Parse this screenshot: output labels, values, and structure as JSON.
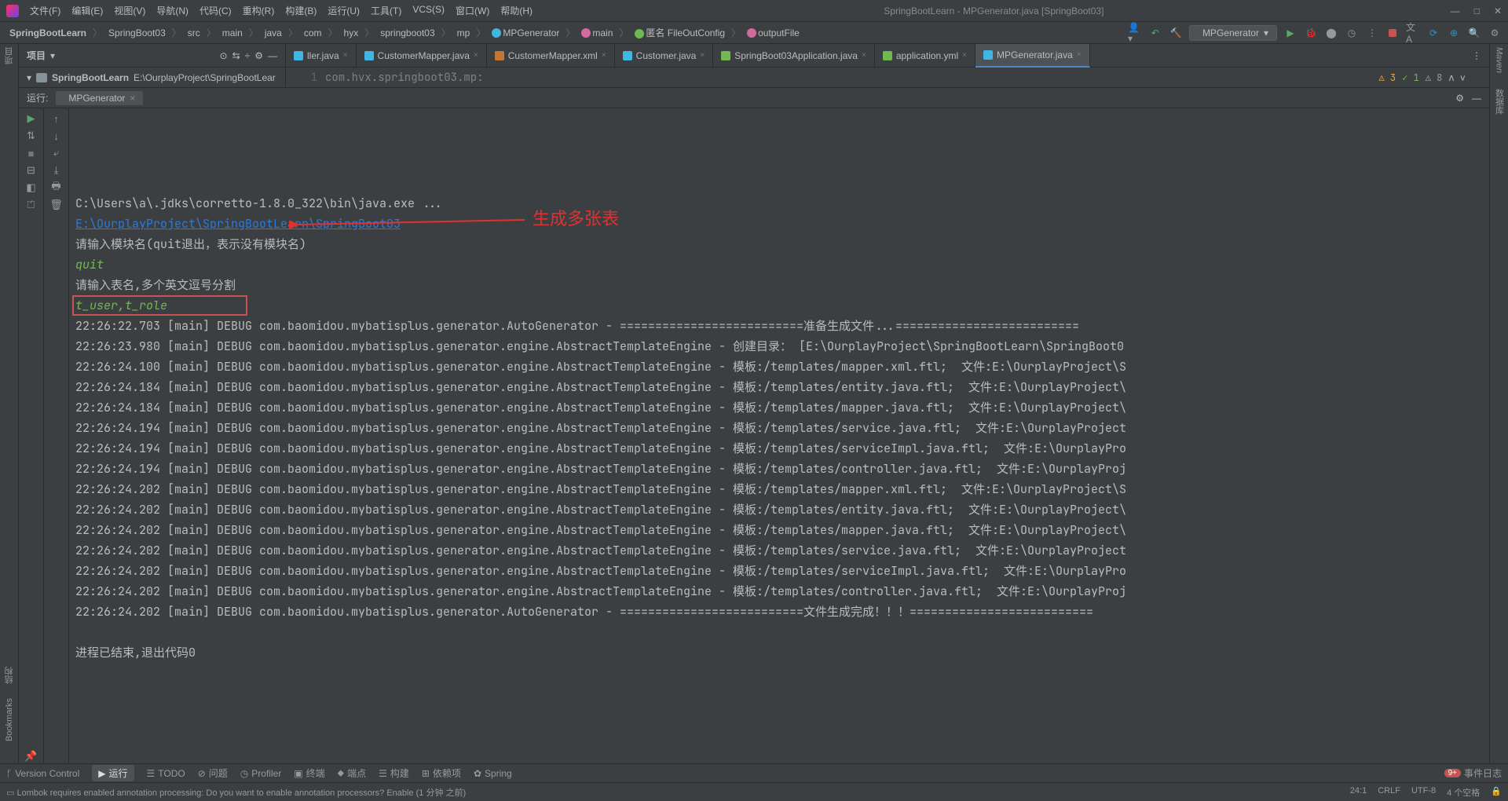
{
  "titlebar": {
    "menus": [
      "文件(F)",
      "编辑(E)",
      "视图(V)",
      "导航(N)",
      "代码(C)",
      "重构(R)",
      "构建(B)",
      "运行(U)",
      "工具(T)",
      "VCS(S)",
      "窗口(W)",
      "帮助(H)"
    ],
    "title": "SpringBootLearn - MPGenerator.java [SpringBoot03]"
  },
  "breadcrumb": [
    "SpringBootLearn",
    "SpringBoot03",
    "src",
    "main",
    "java",
    "com",
    "hyx",
    "springboot03",
    "mp",
    "MPGenerator",
    "main",
    "匿名 FileOutConfig",
    "outputFile"
  ],
  "run_config": "MPGenerator",
  "project_panel": {
    "label": "项目",
    "name": "SpringBootLearn",
    "path": "E:\\OurplayProject\\SpringBootLear"
  },
  "editor_tabs": [
    {
      "label": "ller.java",
      "icon": "#40b6e0"
    },
    {
      "label": "CustomerMapper.java",
      "icon": "#40b6e0"
    },
    {
      "label": "CustomerMapper.xml",
      "icon": "#c57633"
    },
    {
      "label": "Customer.java",
      "icon": "#40b6e0"
    },
    {
      "label": "SpringBoot03Application.java",
      "icon": "#6fb950"
    },
    {
      "label": "application.yml",
      "icon": "#6fb950"
    },
    {
      "label": "MPGenerator.java",
      "icon": "#40b6e0",
      "active": true
    }
  ],
  "editor": {
    "gutter": "1",
    "code": "com.hvx.springboot03.mp:",
    "warn": "3",
    "ok": "1",
    "info": "8"
  },
  "run": {
    "label": "运行:",
    "tab": "MPGenerator",
    "lines": [
      {
        "t": "plain",
        "text": "C:\\Users\\a\\.jdks\\corretto-1.8.0_322\\bin\\java.exe ..."
      },
      {
        "t": "link",
        "text": "E:\\OurplayProject\\SpringBootLearn\\SpringBoot03"
      },
      {
        "t": "plain",
        "text": "请输入模块名(quit退出，表示没有模块名)"
      },
      {
        "t": "green",
        "text": "quit"
      },
      {
        "t": "plain",
        "text": "请输入表名,多个英文逗号分割"
      },
      {
        "t": "green-box",
        "text": "t_user,t_role"
      },
      {
        "t": "plain",
        "text": "22:26:22.703 [main] DEBUG com.baomidou.mybatisplus.generator.AutoGenerator - ==========================准备生成文件...=========================="
      },
      {
        "t": "plain",
        "text": "22:26:23.980 [main] DEBUG com.baomidou.mybatisplus.generator.engine.AbstractTemplateEngine - 创建目录： [E:\\OurplayProject\\SpringBootLearn\\SpringBoot0"
      },
      {
        "t": "plain",
        "text": "22:26:24.100 [main] DEBUG com.baomidou.mybatisplus.generator.engine.AbstractTemplateEngine - 模板:/templates/mapper.xml.ftl;  文件:E:\\OurplayProject\\S"
      },
      {
        "t": "plain",
        "text": "22:26:24.184 [main] DEBUG com.baomidou.mybatisplus.generator.engine.AbstractTemplateEngine - 模板:/templates/entity.java.ftl;  文件:E:\\OurplayProject\\"
      },
      {
        "t": "plain",
        "text": "22:26:24.184 [main] DEBUG com.baomidou.mybatisplus.generator.engine.AbstractTemplateEngine - 模板:/templates/mapper.java.ftl;  文件:E:\\OurplayProject\\"
      },
      {
        "t": "plain",
        "text": "22:26:24.194 [main] DEBUG com.baomidou.mybatisplus.generator.engine.AbstractTemplateEngine - 模板:/templates/service.java.ftl;  文件:E:\\OurplayProject"
      },
      {
        "t": "plain",
        "text": "22:26:24.194 [main] DEBUG com.baomidou.mybatisplus.generator.engine.AbstractTemplateEngine - 模板:/templates/serviceImpl.java.ftl;  文件:E:\\OurplayPro"
      },
      {
        "t": "plain",
        "text": "22:26:24.194 [main] DEBUG com.baomidou.mybatisplus.generator.engine.AbstractTemplateEngine - 模板:/templates/controller.java.ftl;  文件:E:\\OurplayProj"
      },
      {
        "t": "plain",
        "text": "22:26:24.202 [main] DEBUG com.baomidou.mybatisplus.generator.engine.AbstractTemplateEngine - 模板:/templates/mapper.xml.ftl;  文件:E:\\OurplayProject\\S"
      },
      {
        "t": "plain",
        "text": "22:26:24.202 [main] DEBUG com.baomidou.mybatisplus.generator.engine.AbstractTemplateEngine - 模板:/templates/entity.java.ftl;  文件:E:\\OurplayProject\\"
      },
      {
        "t": "plain",
        "text": "22:26:24.202 [main] DEBUG com.baomidou.mybatisplus.generator.engine.AbstractTemplateEngine - 模板:/templates/mapper.java.ftl;  文件:E:\\OurplayProject\\"
      },
      {
        "t": "plain",
        "text": "22:26:24.202 [main] DEBUG com.baomidou.mybatisplus.generator.engine.AbstractTemplateEngine - 模板:/templates/service.java.ftl;  文件:E:\\OurplayProject"
      },
      {
        "t": "plain",
        "text": "22:26:24.202 [main] DEBUG com.baomidou.mybatisplus.generator.engine.AbstractTemplateEngine - 模板:/templates/serviceImpl.java.ftl;  文件:E:\\OurplayPro"
      },
      {
        "t": "plain",
        "text": "22:26:24.202 [main] DEBUG com.baomidou.mybatisplus.generator.engine.AbstractTemplateEngine - 模板:/templates/controller.java.ftl;  文件:E:\\OurplayProj"
      },
      {
        "t": "plain",
        "text": "22:26:24.202 [main] DEBUG com.baomidou.mybatisplus.generator.AutoGenerator - ==========================文件生成完成！！！=========================="
      },
      {
        "t": "blank",
        "text": ""
      },
      {
        "t": "plain",
        "text": "进程已结束,退出代码0"
      }
    ],
    "annotation": "生成多张表"
  },
  "bottom_tabs": [
    "Version Control",
    "运行",
    "TODO",
    "问题",
    "Profiler",
    "终端",
    "端点",
    "构建",
    "依赖项",
    "Spring"
  ],
  "bottom_right": {
    "badge": "9+",
    "label": "事件日志"
  },
  "status": {
    "left": "Lombok requires enabled annotation processing: Do you want to enable annotation processors? Enable (1 分钟 之前)",
    "pos": "24:1",
    "crlf": "CRLF",
    "enc": "UTF-8",
    "indent": "4 个空格"
  },
  "left_rail": [
    "项目",
    "结构",
    "Bookmarks"
  ],
  "right_rail": [
    "Maven",
    "数据库"
  ]
}
